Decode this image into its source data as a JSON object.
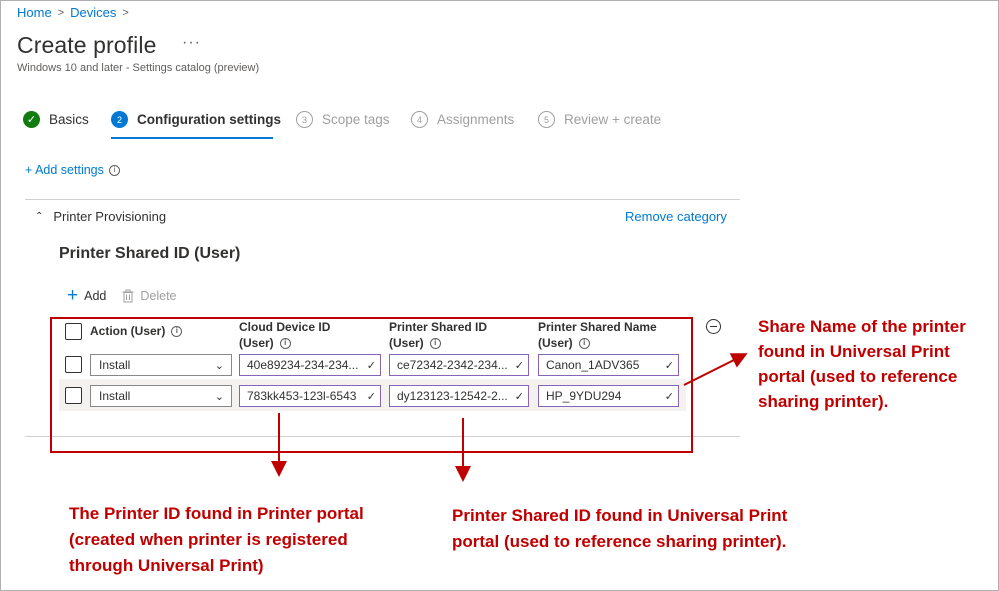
{
  "breadcrumb": {
    "items": [
      "Home",
      "Devices"
    ]
  },
  "page": {
    "title": "Create profile",
    "more": "···",
    "subtitle": "Windows 10 and later - Settings catalog (preview)"
  },
  "wizard": {
    "steps": [
      {
        "number": "✓",
        "label": "Basics",
        "state": "done"
      },
      {
        "number": "2",
        "label": "Configuration settings",
        "state": "active"
      },
      {
        "number": "3",
        "label": "Scope tags",
        "state": "pending"
      },
      {
        "number": "4",
        "label": "Assignments",
        "state": "pending"
      },
      {
        "number": "5",
        "label": "Review + create",
        "state": "pending"
      }
    ]
  },
  "add_settings_label": "+ Add settings",
  "category": {
    "name": "Printer Provisioning",
    "remove_label": "Remove category"
  },
  "setting": {
    "title": "Printer Shared ID (User)",
    "toolbar": {
      "add_label": "Add",
      "delete_label": "Delete"
    },
    "columns": [
      {
        "line1": "Action (User)",
        "line2": ""
      },
      {
        "line1": "Cloud Device ID",
        "line2": "(User)"
      },
      {
        "line1": "Printer Shared ID",
        "line2": "(User)"
      },
      {
        "line1": "Printer Shared Name",
        "line2": "(User)"
      }
    ],
    "rows": [
      {
        "action": "Install",
        "cloud_device_id": "40e89234-234-234...",
        "printer_shared_id": "ce72342-2342-234...",
        "printer_shared_name": "Canon_1ADV365"
      },
      {
        "action": "Install",
        "cloud_device_id": "783kk453-123l-6543",
        "printer_shared_id": "dy123123-12542-2...",
        "printer_shared_name": "HP_9YDU294"
      }
    ]
  },
  "annotations": {
    "right": "Share Name of the printer found in Universal Print portal (used to reference sharing printer).",
    "bottom_left": "The Printer ID found in Printer portal (created when printer is registered through Universal Print)",
    "bottom_right": "Printer Shared ID found in Universal Print portal (used to reference sharing printer).",
    "color": "#c00000"
  },
  "colors": {
    "accent": "#0078d4",
    "success": "#107c10",
    "field_border": "#8764b8"
  },
  "icons": {
    "info": "info-icon",
    "chevron_right": "chevron-right-icon",
    "chevron_up": "chevron-up-icon",
    "chevron_down": "chevron-down-icon",
    "add": "add-icon",
    "delete": "trash-icon",
    "check": "checkmark-icon",
    "remove": "remove-circle-icon"
  }
}
